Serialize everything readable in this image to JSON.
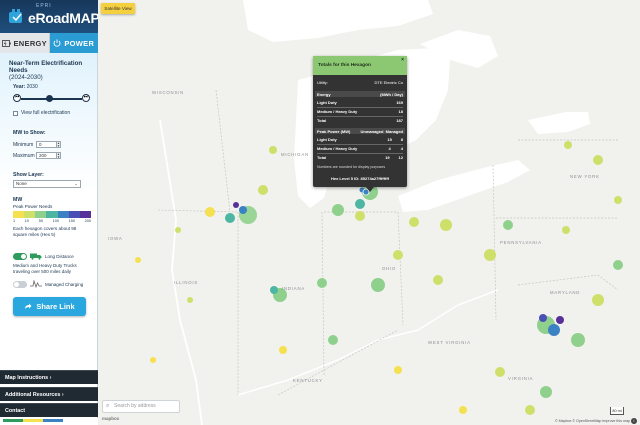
{
  "app": {
    "logo_sub": "EPRI",
    "logo_text": "eRoadMAP",
    "tabs": [
      {
        "label": "ENERGY",
        "icon": "battery-icon",
        "active": false
      },
      {
        "label": "POWER",
        "icon": "power-icon",
        "active": true
      }
    ]
  },
  "panel": {
    "title": "Near-Term Electrification Needs",
    "title_small": "(2024-2030)",
    "year_label": "Year:",
    "year_value": "2030",
    "view_full": "View full electrification",
    "mw_to_show": "MW to Show:",
    "minimum_label": "Minimum",
    "minimum_value": "0",
    "maximum_label": "Maximum",
    "maximum_value": "200",
    "show_layer_label": "Show Layer:",
    "show_layer_value": "None",
    "mw_label": "MW",
    "legend_title": "Peak Power Needs",
    "legend_ticks": [
      "1",
      "10",
      "50",
      "100",
      "150",
      "200"
    ],
    "legend_colors": [
      "#f5e04f",
      "#cfe06a",
      "#8fd18c",
      "#4cb6a3",
      "#3b82c4",
      "#4a4fb5",
      "#57309a"
    ],
    "hex_note": "Each hexagon covers about 98 square miles (Hex 5)",
    "long_distance_label": "Long Distance",
    "trucks_note": "Medium and Heavy Duty Trucks traveling over 500 miles daily",
    "managed_charging": "Managed Charging",
    "share_label": "Share Link"
  },
  "menu": {
    "instructions": "Map Instructions",
    "additional": "Additional Resources",
    "contact": "Contact"
  },
  "map": {
    "satellite_button": "Satellite View",
    "search_placeholder": "Search by address",
    "mapbox": "mapbox",
    "attribution": "© Mapbox © OpenStreetMap Improve this map",
    "scale": "80 mi",
    "state_labels": [
      "WISCONSIN",
      "MICHIGAN",
      "IOWA",
      "ILLINOIS",
      "INDIANA",
      "OHIO",
      "PENNSYLVANIA",
      "NEW YORK",
      "WEST VIRGINIA",
      "VIRGINIA",
      "KENTUCKY",
      "MARYLAND"
    ]
  },
  "popup": {
    "title": "Totals for this Hexagon",
    "utility_label": "Utility:",
    "utility_value": "DTE Electric Co",
    "energy_header": "Energy",
    "energy_unit": "(MWh / Day)",
    "energy_rows": [
      {
        "label": "Light Duty",
        "value": "169"
      },
      {
        "label": "Medium / Heavy Duty",
        "value": "18"
      },
      {
        "label": "Total",
        "value": "187"
      }
    ],
    "power_header": "Peak Power (MW)",
    "power_col1": "Unmanaged",
    "power_col2": "Managed",
    "power_rows": [
      {
        "label": "Light Duty",
        "unmanaged": "15",
        "managed": "8"
      },
      {
        "label": "Medium / Heavy Duty",
        "unmanaged": "4",
        "managed": "4"
      },
      {
        "label": "Total",
        "unmanaged": "19",
        "managed": "12"
      }
    ],
    "note": "Numbers are rounded for display purposes",
    "hex_id": "Hex Level 5 ID: 85274a27ffffffff"
  }
}
